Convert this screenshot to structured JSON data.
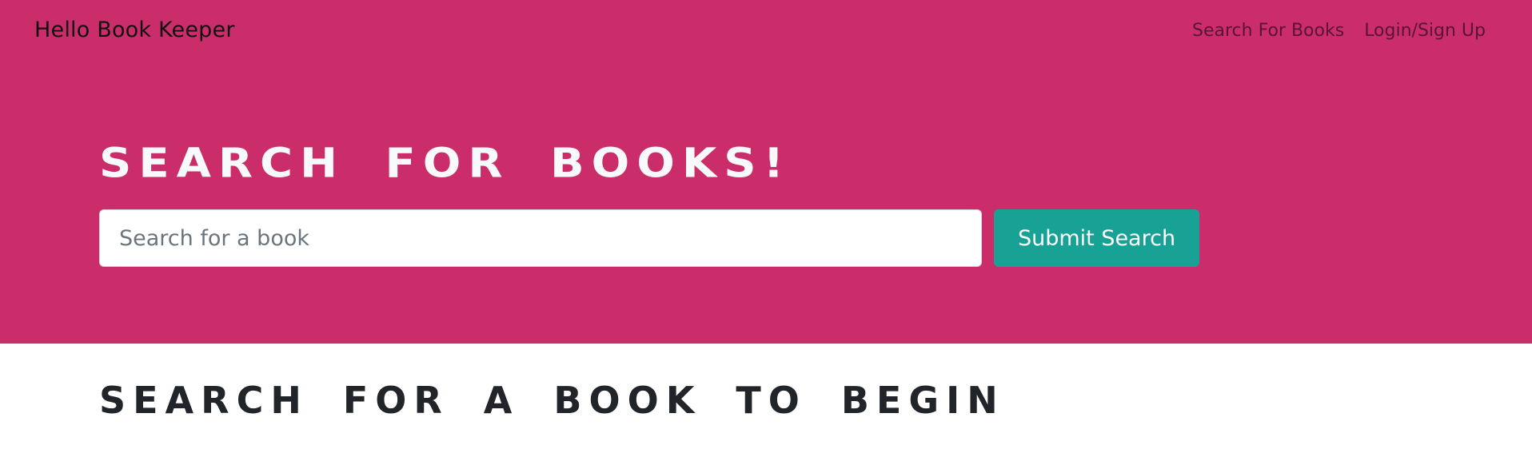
{
  "navbar": {
    "brand": "Hello Book Keeper",
    "links": [
      {
        "label": "Search For Books"
      },
      {
        "label": "Login/Sign Up"
      }
    ]
  },
  "hero": {
    "title": "Search For Books!",
    "search": {
      "placeholder": "Search for a book",
      "value": ""
    },
    "submit_label": "Submit Search"
  },
  "results": {
    "title": "Search for a book to begin"
  },
  "colors": {
    "hero_background": "#cb2d6b",
    "submit_button": "#17a295",
    "heading_dark": "#212529",
    "heading_light": "#f8f9fa"
  }
}
